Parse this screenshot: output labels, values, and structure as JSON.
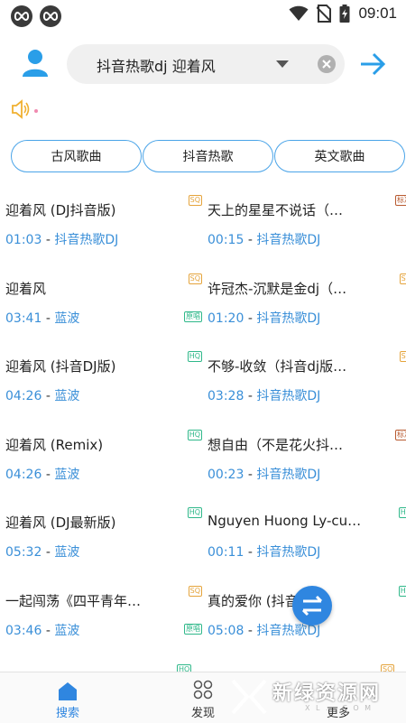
{
  "status_bar": {
    "time": "09:01"
  },
  "search": {
    "query": "抖音热歌dj 迎着风"
  },
  "tabs": [
    {
      "label": "古风歌曲"
    },
    {
      "label": "抖音热歌"
    },
    {
      "label": "英文歌曲"
    }
  ],
  "songs": [
    {
      "title": "迎着风 (DJ抖音版)",
      "duration": "01:03",
      "artist": "抖音热歌DJ",
      "badges": [
        "SQ"
      ]
    },
    {
      "title": "天上的星星不说话（…",
      "duration": "00:15",
      "artist": "抖音热歌DJ",
      "badges": [
        "标准"
      ]
    },
    {
      "title": "迎着风",
      "duration": "03:41",
      "artist": "蓝波",
      "badges": [
        "SQ",
        "原唱"
      ]
    },
    {
      "title": "许冠杰-沉默是金dj（…",
      "duration": "01:20",
      "artist": "抖音热歌DJ",
      "badges": [
        "SQ"
      ]
    },
    {
      "title": "迎着风 (抖音DJ版)",
      "duration": "04:26",
      "artist": "蓝波",
      "badges": [
        "HQ"
      ]
    },
    {
      "title": "不够-收敛（抖音dj版…",
      "duration": "03:28",
      "artist": "抖音热歌DJ",
      "badges": [
        "SQ"
      ]
    },
    {
      "title": "迎着风 (Remix)",
      "duration": "04:26",
      "artist": "蓝波",
      "badges": [
        "HQ"
      ]
    },
    {
      "title": "想自由（不是花火抖…",
      "duration": "00:23",
      "artist": "抖音热歌DJ",
      "badges": [
        "标准"
      ]
    },
    {
      "title": "迎着风 (DJ最新版)",
      "duration": "05:32",
      "artist": "蓝波",
      "badges": [
        "HQ"
      ]
    },
    {
      "title": "Nguyen Huong Ly-cu…",
      "duration": "00:11",
      "artist": "抖音热歌DJ",
      "badges": [
        "HQ"
      ]
    },
    {
      "title": "一起闯荡《四平青年…",
      "duration": "03:46",
      "artist": "蓝波",
      "badges": [
        "SQ",
        "原唱"
      ]
    },
    {
      "title": "真的爱你 (抖音",
      "duration": "05:08",
      "artist": "抖音热歌DJ",
      "badges": [
        "HQ"
      ]
    }
  ],
  "partial_badges": [
    "HQ",
    "SQ"
  ],
  "meta_separator": "-",
  "bottom_nav": [
    {
      "label": "搜索",
      "icon": "home-icon",
      "active": true
    },
    {
      "label": "发现",
      "icon": "grid-icon",
      "active": false
    },
    {
      "label": "更多",
      "icon": "more-icon",
      "active": false
    }
  ],
  "watermark": {
    "title": "新绿资源网",
    "sub": "X L ... C O M"
  },
  "colors": {
    "accent": "#2f86e0",
    "link": "#3a8fd8",
    "sq": "#e5a43c",
    "hq": "#2fb88a",
    "std": "#b85a30"
  }
}
